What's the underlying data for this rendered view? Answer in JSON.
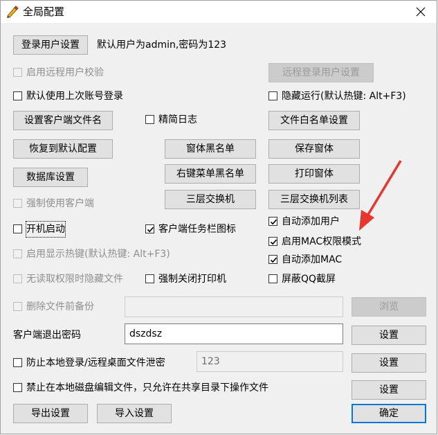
{
  "window": {
    "title": "全局配置",
    "close_glyph": "✕"
  },
  "colors": {
    "accent": "#0078d7",
    "arrow": "#e8352d",
    "check": "#000000"
  },
  "buttons": {
    "login_user_settings": "登录用户设置",
    "remote_login_user_settings": "远程登录用户设置",
    "set_client_filename": "设置客户端文件名",
    "file_whitelist_settings": "文件白名单设置",
    "restore_defaults": "恢复到默认配置",
    "window_blacklist": "窗体黑名单",
    "save_window": "保存窗体",
    "database_settings": "数据库设置",
    "right_menu_blacklist": "右键菜单黑名单",
    "print_window": "打印窗体",
    "l3_switch": "三层交换机",
    "l3_switch_list": "三层交换机列表",
    "browse": "浏览",
    "set_exit_password": "设置",
    "set_prevent_leak": "设置",
    "set_disk_edit": "设置",
    "export_settings": "导出设置",
    "import_settings": "导入设置",
    "ok": "确定"
  },
  "labels": {
    "default_user_info": "默认用户为admin,密码为123",
    "client_exit_password": "客户端退出密码"
  },
  "checkboxes": {
    "enable_remote_user_verify": {
      "label": "启用远程用户校验",
      "checked": false,
      "enabled": false
    },
    "use_last_account": {
      "label": "默认使用上次账号登录",
      "checked": false,
      "enabled": true
    },
    "hide_running": {
      "label": "隐藏运行(默认热键: Alt+F3)",
      "checked": false,
      "enabled": true
    },
    "simple_log": {
      "label": "精简日志",
      "checked": false,
      "enabled": true
    },
    "force_client": {
      "label": "强制使用客户端",
      "checked": false,
      "enabled": false
    },
    "startup": {
      "label": "开机启动",
      "checked": false,
      "enabled": true
    },
    "taskbar_icon": {
      "label": "客户端任务栏图标",
      "checked": true,
      "enabled": true
    },
    "auto_add_user": {
      "label": "自动添加用户",
      "checked": true,
      "enabled": true
    },
    "enable_mac_permission": {
      "label": "启用MAC权限模式",
      "checked": true,
      "enabled": true
    },
    "show_hotkey": {
      "label": "启用显示热键(默认热键: Alt+F3)",
      "checked": false,
      "enabled": false
    },
    "auto_add_mac": {
      "label": "自动添加MAC",
      "checked": true,
      "enabled": true
    },
    "hide_when_no_permission": {
      "label": "无读取权限时隐藏文件",
      "checked": false,
      "enabled": false
    },
    "force_close_printer": {
      "label": "强制关闭打印机",
      "checked": false,
      "enabled": true
    },
    "block_qq_screenshot": {
      "label": "屏蔽QQ截屏",
      "checked": false,
      "enabled": true
    },
    "backup_before_delete": {
      "label": "删除文件前备份",
      "checked": false,
      "enabled": false
    },
    "prevent_leak": {
      "label": "防止本地登录/远程桌面文件泄密",
      "checked": false,
      "enabled": true
    },
    "disable_local_disk_edit": {
      "label": "禁止在本地磁盘编辑文件，只允许在共享目录下操作文件",
      "checked": false,
      "enabled": true
    }
  },
  "inputs": {
    "backup_path": {
      "value": "",
      "enabled": false
    },
    "exit_password": {
      "value": "dszdsz",
      "enabled": true
    },
    "prevent_leak_value": {
      "value": "123",
      "enabled": false
    }
  }
}
